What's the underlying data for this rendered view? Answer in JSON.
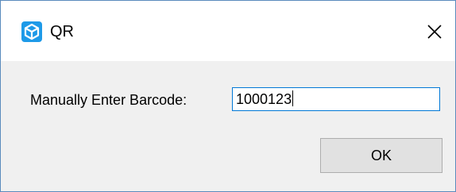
{
  "window": {
    "title": "QR",
    "icon": "cube-icon",
    "accent_color": "#1e9ae8"
  },
  "form": {
    "barcode_label": "Manually Enter Barcode:",
    "barcode_value": "1000123",
    "input_border_color": "#0078d7"
  },
  "buttons": {
    "ok_label": "OK",
    "close_icon": "close-icon"
  }
}
